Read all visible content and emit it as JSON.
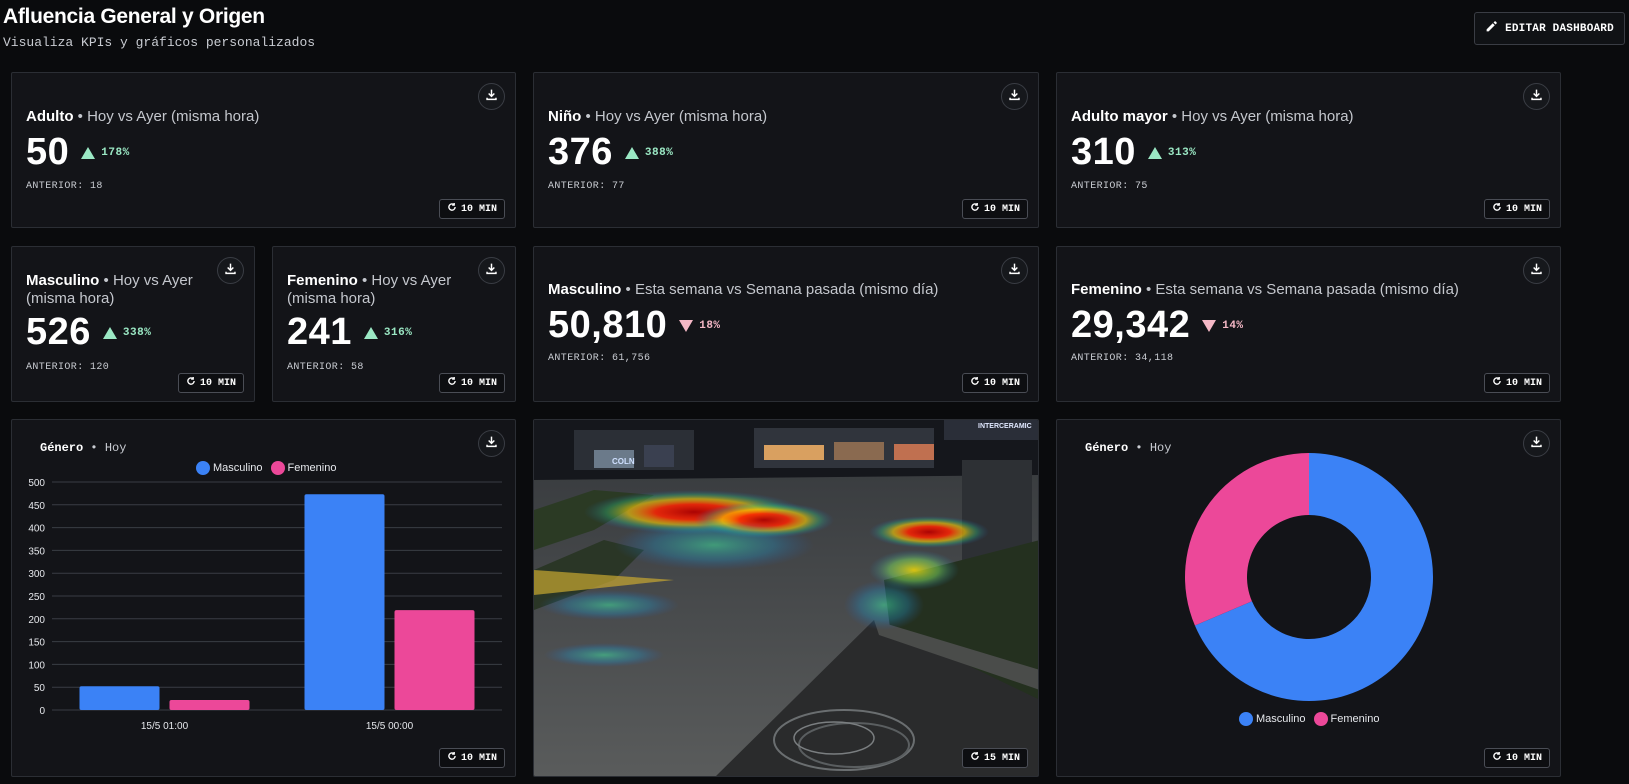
{
  "header": {
    "title": "Afluencia General y Origen",
    "subtitle": "Visualiza KPIs y gráficos personalizados",
    "edit_label": "EDITAR DASHBOARD"
  },
  "colors": {
    "masculino": "#3b82f6",
    "femenino": "#ec4899",
    "up": "#9be8c4",
    "down": "#f5b8c6"
  },
  "kpis": [
    {
      "label": "Adulto",
      "period": " • Hoy vs Ayer (misma hora)",
      "value": "50",
      "delta": "178%",
      "direction": "up",
      "previous": "ANTERIOR: 18",
      "refresh": "10 MIN"
    },
    {
      "label": "Niño",
      "period": " • Hoy vs Ayer (misma hora)",
      "value": "376",
      "delta": "388%",
      "direction": "up",
      "previous": "ANTERIOR: 77",
      "refresh": "10 MIN"
    },
    {
      "label": "Adulto mayor",
      "period": " • Hoy vs Ayer (misma hora)",
      "value": "310",
      "delta": "313%",
      "direction": "up",
      "previous": "ANTERIOR: 75",
      "refresh": "10 MIN"
    },
    {
      "label": "Masculino",
      "period": " • Hoy vs Ayer (misma hora)",
      "value": "526",
      "delta": "338%",
      "direction": "up",
      "previous": "ANTERIOR: 120",
      "refresh": "10 MIN"
    },
    {
      "label": "Femenino",
      "period": " • Hoy vs Ayer (misma hora)",
      "value": "241",
      "delta": "316%",
      "direction": "up",
      "previous": "ANTERIOR: 58",
      "refresh": "10 MIN"
    },
    {
      "label": "Masculino",
      "period": " • Esta semana vs Semana pasada (mismo día)",
      "value": "50,810",
      "delta": "18%",
      "direction": "down",
      "previous": "ANTERIOR: 61,756",
      "refresh": "10 MIN"
    },
    {
      "label": "Femenino",
      "period": " • Esta semana vs Semana pasada (mismo día)",
      "value": "29,342",
      "delta": "14%",
      "direction": "down",
      "previous": "ANTERIOR: 34,118",
      "refresh": "10 MIN"
    }
  ],
  "heatmap": {
    "refresh": "15 MIN",
    "sign_text": "INTERCERAMIC",
    "store_text": "COLN"
  },
  "chart_data": [
    {
      "type": "bar",
      "title": "Género",
      "subtitle": "Hoy",
      "categories": [
        "15/5 01:00",
        "15/5 00:00"
      ],
      "series": [
        {
          "name": "Masculino",
          "values": [
            52,
            473
          ]
        },
        {
          "name": "Femenino",
          "values": [
            22,
            219
          ]
        }
      ],
      "yticks": [
        "0",
        "50",
        "100",
        "150",
        "200",
        "250",
        "300",
        "350",
        "400",
        "450",
        "500"
      ],
      "ylim": [
        0,
        500
      ],
      "grid": true,
      "legend": "top-center",
      "refresh": "10 MIN"
    },
    {
      "type": "pie",
      "title": "Género",
      "subtitle": "Hoy",
      "labels": [
        "Masculino",
        "Femenino"
      ],
      "values": [
        68.6,
        31.4
      ],
      "legend": "bottom-center",
      "refresh": "10 MIN"
    }
  ]
}
